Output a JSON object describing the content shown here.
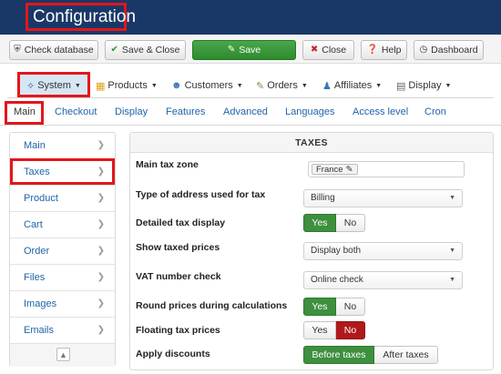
{
  "header": {
    "title": "Configuration"
  },
  "toolbar": {
    "check_database": "Check database",
    "save_close": "Save & Close",
    "save": "Save",
    "close": "Close",
    "help": "Help",
    "dashboard": "Dashboard"
  },
  "menu": {
    "system": "System",
    "products": "Products",
    "customers": "Customers",
    "orders": "Orders",
    "affiliates": "Affiliates",
    "display": "Display"
  },
  "tabs": [
    "Main",
    "Checkout",
    "Display",
    "Features",
    "Advanced",
    "Languages",
    "Access level",
    "Cron"
  ],
  "sidebar": {
    "items": [
      "Main",
      "Taxes",
      "Product",
      "Cart",
      "Order",
      "Files",
      "Images",
      "Emails"
    ]
  },
  "panel": {
    "title": "TAXES",
    "main_tax_zone": {
      "label": "Main tax zone",
      "value": "France"
    },
    "address_type": {
      "label": "Type of address used for tax",
      "value": "Billing"
    },
    "detailed_display": {
      "label": "Detailed tax display",
      "yes": "Yes",
      "no": "No",
      "selected": "Yes"
    },
    "show_taxed_prices": {
      "label": "Show taxed prices",
      "value": "Display both"
    },
    "vat_check": {
      "label": "VAT number check",
      "value": "Online check"
    },
    "round_prices": {
      "label": "Round prices during calculations",
      "yes": "Yes",
      "no": "No",
      "selected": "Yes"
    },
    "floating_tax": {
      "label": "Floating tax prices",
      "yes": "Yes",
      "no": "No",
      "selected": "No"
    },
    "apply_discounts": {
      "label": "Apply discounts",
      "before": "Before taxes",
      "after": "After taxes",
      "selected": "Before taxes"
    }
  },
  "colors": {
    "header_bg": "#1a3867",
    "highlight": "#e3161b",
    "save_green": "#2e8b2e",
    "link_blue": "#1f64a8",
    "no_red": "#b0191b"
  }
}
